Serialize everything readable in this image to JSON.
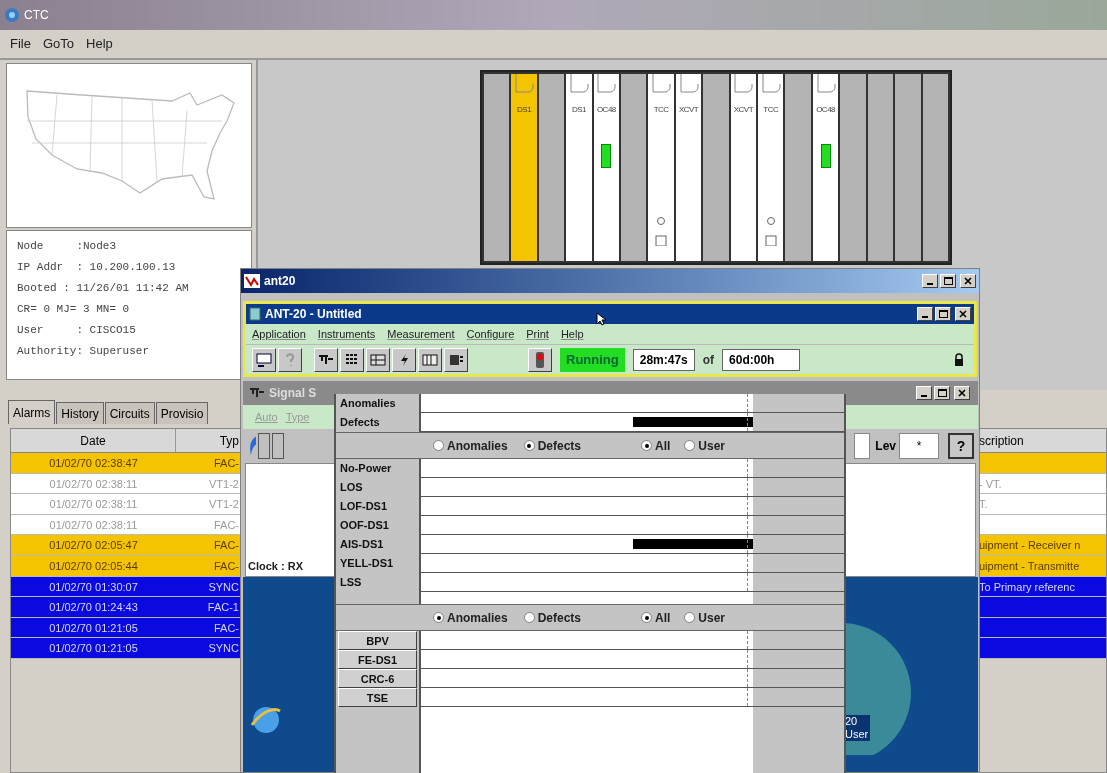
{
  "window": {
    "title": "CTC"
  },
  "menu": [
    "File",
    "GoTo",
    "Help"
  ],
  "node_info": [
    "Node     :Node3",
    "IP Addr  : 10.200.100.13",
    "Booted : 11/26/01 11:42 AM",
    "CR= 0 MJ= 3 MN= 0",
    "User     : CISCO15",
    "Authority: Superuser"
  ],
  "shelf": {
    "slots": [
      {
        "kind": "empty"
      },
      {
        "kind": "card",
        "label": "DS1",
        "alarm": true,
        "led": false,
        "port": false
      },
      {
        "kind": "empty"
      },
      {
        "kind": "card",
        "label": "DS1",
        "alarm": false,
        "led": false,
        "port": false
      },
      {
        "kind": "card",
        "label": "OC48",
        "alarm": false,
        "led": true,
        "port": false
      },
      {
        "kind": "empty"
      },
      {
        "kind": "card",
        "label": "TCC",
        "alarm": false,
        "led": false,
        "port": true
      },
      {
        "kind": "card",
        "label": "XCVT",
        "alarm": false,
        "led": false,
        "port": false
      },
      {
        "kind": "empty"
      },
      {
        "kind": "card",
        "label": "XCVT",
        "alarm": false,
        "led": false,
        "port": false
      },
      {
        "kind": "card",
        "label": "TCC",
        "alarm": false,
        "led": false,
        "port": true
      },
      {
        "kind": "empty"
      },
      {
        "kind": "card",
        "label": "OC48",
        "alarm": false,
        "led": true,
        "port": false
      },
      {
        "kind": "empty"
      },
      {
        "kind": "empty"
      },
      {
        "kind": "empty"
      },
      {
        "kind": "empty"
      }
    ]
  },
  "tabs": [
    {
      "label": "Alarms",
      "selected": true
    },
    {
      "label": "History",
      "selected": false
    },
    {
      "label": "Circuits",
      "selected": false
    },
    {
      "label": "Provisio",
      "selected": false
    }
  ],
  "alarms": {
    "columns": [
      "Date",
      "Typ",
      "scription"
    ],
    "rows": [
      {
        "kind": "minor",
        "date": "01/02/70 02:38:47",
        "type": "FAC-",
        "description": ""
      },
      {
        "kind": "cleared",
        "date": "01/02/70 02:38:11",
        "type": "VT1-2",
        "description": "- VT."
      },
      {
        "kind": "cleared",
        "date": "01/02/70 02:38:11",
        "type": "VT1-2",
        "description": "T."
      },
      {
        "kind": "cleared",
        "date": "01/02/70 02:38:11",
        "type": "FAC-",
        "description": ""
      },
      {
        "kind": "minor",
        "date": "01/02/70 02:05:47",
        "type": "FAC-",
        "description": "uipment - Receiver n"
      },
      {
        "kind": "minor",
        "date": "01/02/70 02:05:44",
        "type": "FAC-",
        "description": "uipment - Transmitte"
      },
      {
        "kind": "condition",
        "date": "01/02/70 01:30:07",
        "type": "SYNC",
        "description": "To Primary referenc"
      },
      {
        "kind": "condition",
        "date": "01/02/70 01:24:43",
        "type": "FAC-1",
        "description": ""
      },
      {
        "kind": "condition",
        "date": "01/02/70 01:21:05",
        "type": "FAC-",
        "description": ""
      },
      {
        "kind": "condition",
        "date": "01/02/70 01:21:05",
        "type": "SYNC",
        "description": ""
      }
    ]
  },
  "ant20_window": {
    "title": "ant20",
    "app": {
      "title": "ANT-20 - Untitled",
      "menu": [
        "Application",
        "Instruments",
        "Measurement",
        "Configure",
        "Print",
        "Help"
      ],
      "status": "Running",
      "elapsed": "28m:47s",
      "of": "of",
      "duration": "60d:00h"
    },
    "signal_window": {
      "title": "Signal S",
      "menu": [
        "Auto",
        "Type"
      ],
      "clock": "Clock : RX",
      "level_label": "Lev",
      "level_value": "*",
      "help_button": "?"
    },
    "desktop_shortcut": [
      "20",
      "User"
    ],
    "monitor": {
      "summary": [
        {
          "label": "Anomalies",
          "level": 0
        },
        {
          "label": "Defects",
          "level": 0.36
        }
      ],
      "filter_1": {
        "type": [
          {
            "label": "Anomalies",
            "selected": false
          },
          {
            "label": "Defects",
            "selected": true
          }
        ],
        "scope": [
          {
            "label": "All",
            "selected": true
          },
          {
            "label": "User",
            "selected": false
          }
        ]
      },
      "defects": [
        {
          "label": "No-Power",
          "level": 0
        },
        {
          "label": "LOS",
          "level": 0
        },
        {
          "label": "LOF-DS1",
          "level": 0
        },
        {
          "label": "OOF-DS1",
          "level": 0
        },
        {
          "label": "AIS-DS1",
          "level": 0.36
        },
        {
          "label": "YELL-DS1",
          "level": 0
        },
        {
          "label": "LSS",
          "level": 0
        }
      ],
      "filter_2": {
        "type": [
          {
            "label": "Anomalies",
            "selected": true
          },
          {
            "label": "Defects",
            "selected": false
          }
        ],
        "scope": [
          {
            "label": "All",
            "selected": true
          },
          {
            "label": "User",
            "selected": false
          }
        ]
      },
      "anomalies": [
        {
          "label": "BPV",
          "level": 0
        },
        {
          "label": "FE-DS1",
          "level": 0
        },
        {
          "label": "CRC-6",
          "level": 0
        },
        {
          "label": "TSE",
          "level": 0
        }
      ]
    }
  }
}
